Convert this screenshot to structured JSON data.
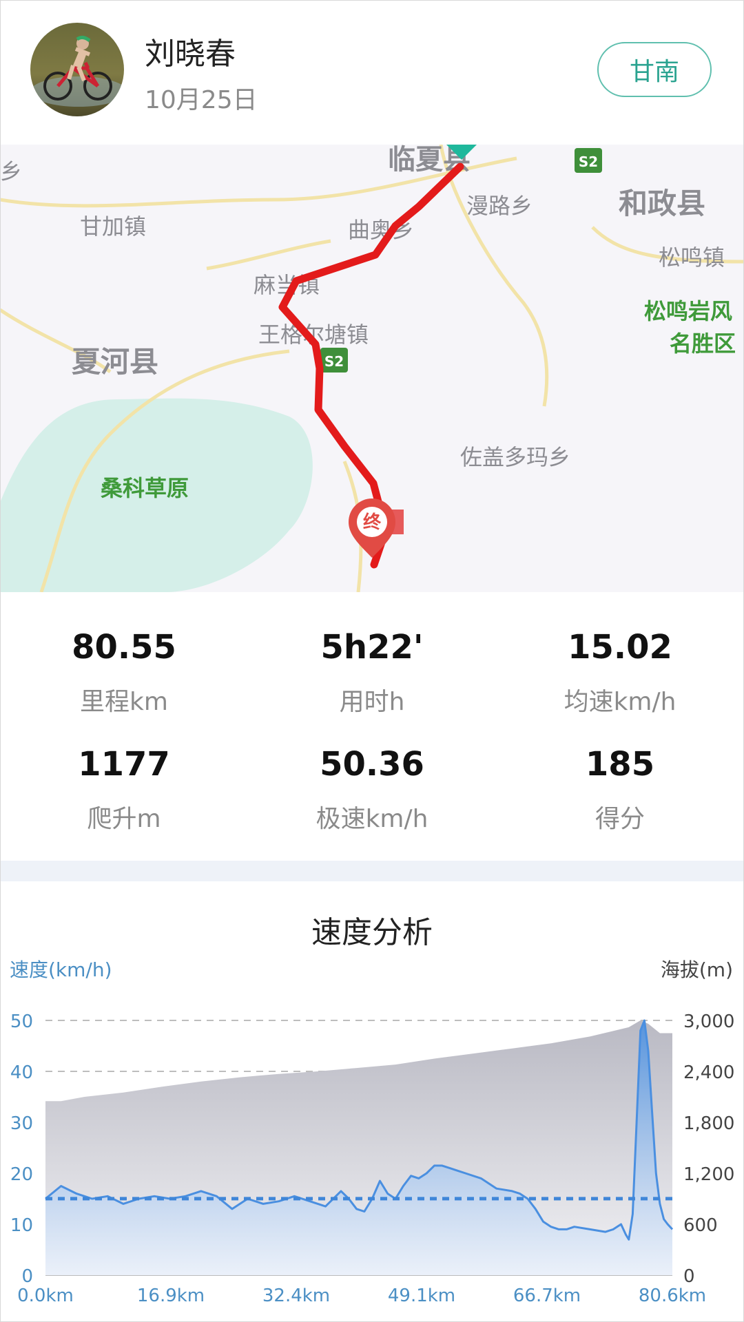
{
  "header": {
    "username": "刘晓春",
    "date": "10月25日",
    "region_button": "甘南"
  },
  "map": {
    "labels": {
      "linxia": "临夏县",
      "mantu": "漫路乡",
      "hezheng": "和政县",
      "ganjia": "甘加镇",
      "quao": "曲奥乡",
      "songming": "松鸣镇",
      "songmingyan_1": "松鸣岩风",
      "songmingyan_2": "名胜区",
      "madang": "麻当镇",
      "wanggeer": "王格尔塘镇",
      "xiahe": "夏河县",
      "zuogai": "佐盖多玛乡",
      "sangke": "桑科草原",
      "left_edge": "乡",
      "s2_top": "S2",
      "s2_mid": "S2",
      "end_marker": "终"
    },
    "colors": {
      "route": "#e31b1b",
      "water": "#cfeee8",
      "road": "#f3df9a",
      "start": "#1fb89c"
    }
  },
  "stats": {
    "distance": {
      "value": "80.55",
      "label": "里程km"
    },
    "duration": {
      "value": "5h22'",
      "label": "用时h"
    },
    "avg_speed": {
      "value": "15.02",
      "label": "均速km/h"
    },
    "climb": {
      "value": "1177",
      "label": "爬升m"
    },
    "max_speed": {
      "value": "50.36",
      "label": "极速km/h"
    },
    "score": {
      "value": "185",
      "label": "得分"
    }
  },
  "chart_title": "速度分析",
  "chart_data": {
    "type": "area",
    "y_left_label": "速度(km/h)",
    "y_right_label": "海拔(m)",
    "x_ticks": [
      "0.0km",
      "16.9km",
      "32.4km",
      "49.1km",
      "66.7km",
      "80.6km"
    ],
    "y_left_ticks": [
      "0",
      "10",
      "20",
      "30",
      "40",
      "50"
    ],
    "y_right_ticks": [
      "0",
      "600",
      "1,200",
      "1,800",
      "2,400",
      "3,000"
    ],
    "xlim": [
      0,
      80.6
    ],
    "ylim_left": [
      0,
      50
    ],
    "ylim_right": [
      0,
      3000
    ],
    "average_speed": 15.02,
    "grid": true,
    "series": [
      {
        "name": "速度",
        "axis": "left",
        "x": [
          0,
          2,
          4,
          6,
          8,
          10,
          12,
          14,
          16,
          18,
          20,
          22,
          24,
          26,
          28,
          30,
          32,
          34,
          36,
          38,
          39,
          40,
          41,
          42,
          43,
          44,
          45,
          46,
          47,
          48,
          49,
          50,
          51,
          52,
          53,
          54,
          56,
          58,
          60,
          61,
          62,
          63,
          64,
          65,
          66,
          67,
          68,
          70,
          72,
          73,
          74,
          74.6,
          75,
          75.5,
          76,
          76.5,
          77,
          77.5,
          78,
          78.5,
          79,
          79.5,
          80,
          80.6
        ],
        "values": [
          15,
          17.5,
          16,
          15,
          15.5,
          14,
          15,
          15.5,
          15,
          15.5,
          16.5,
          15.5,
          13,
          15,
          14,
          14.5,
          15.5,
          14.5,
          13.5,
          16.5,
          15,
          13,
          12.5,
          15,
          18.5,
          16,
          15,
          17.5,
          19.5,
          19,
          20,
          21.5,
          21.5,
          21,
          20.5,
          20,
          19,
          17,
          16.5,
          16,
          15,
          13,
          10.5,
          9.5,
          9,
          9,
          9.5,
          9,
          8.5,
          9,
          10,
          8,
          7,
          12,
          30,
          48,
          50,
          44,
          32,
          20,
          14,
          11,
          10,
          9
        ]
      },
      {
        "name": "海拔",
        "axis": "right",
        "x": [
          0,
          2,
          5,
          10,
          15,
          20,
          25,
          30,
          35,
          40,
          45,
          50,
          55,
          60,
          65,
          70,
          75,
          76.5,
          77.5,
          79,
          80.6
        ],
        "values": [
          2050,
          2050,
          2100,
          2150,
          2220,
          2280,
          2330,
          2370,
          2400,
          2440,
          2480,
          2550,
          2610,
          2670,
          2730,
          2810,
          2920,
          3000,
          2960,
          2850,
          2850
        ]
      }
    ]
  }
}
